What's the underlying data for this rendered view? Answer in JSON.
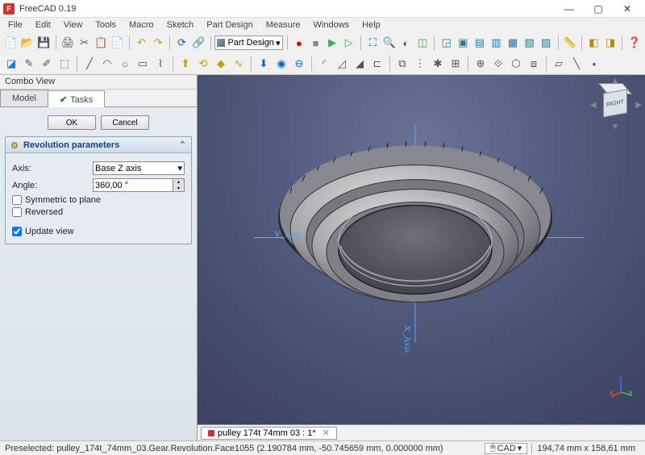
{
  "app": {
    "title": "FreeCAD 0.19",
    "icon_letter": "F"
  },
  "window_buttons": {
    "minimize": "—",
    "maximize": "▢",
    "close": "✕"
  },
  "menu": [
    "File",
    "Edit",
    "View",
    "Tools",
    "Macro",
    "Sketch",
    "Part Design",
    "Measure",
    "Windows",
    "Help"
  ],
  "workbench": {
    "label": "Part Design"
  },
  "combo": {
    "title": "Combo View",
    "tabs": {
      "model": "Model",
      "tasks": "Tasks"
    },
    "buttons": {
      "ok": "OK",
      "cancel": "Cancel"
    },
    "panel": {
      "title": "Revolution parameters",
      "axis_label": "Axis:",
      "axis_value": "Base Z axis",
      "angle_label": "Angle:",
      "angle_value": "360,00 °",
      "symmetric": "Symmetric to plane",
      "reversed": "Reversed",
      "update": "Update view"
    }
  },
  "viewport": {
    "y_axis_label": "Y_Axis",
    "x_axis_label": "X_Axis",
    "navcube_face": "RIGHT"
  },
  "doctab": {
    "label": "pulley 174t 74mm 03 : 1*"
  },
  "status": {
    "preselect": "Preselected: pulley_174t_74mm_03.Gear.Revolution.Face1055 (2.190784 mm, -50.745659 mm, 0.000000 mm)",
    "nav_mode": "CAD",
    "dims": "194,74 mm x 158,61 mm"
  },
  "gizmo": {
    "x": "x",
    "y": "y",
    "z": "z"
  }
}
